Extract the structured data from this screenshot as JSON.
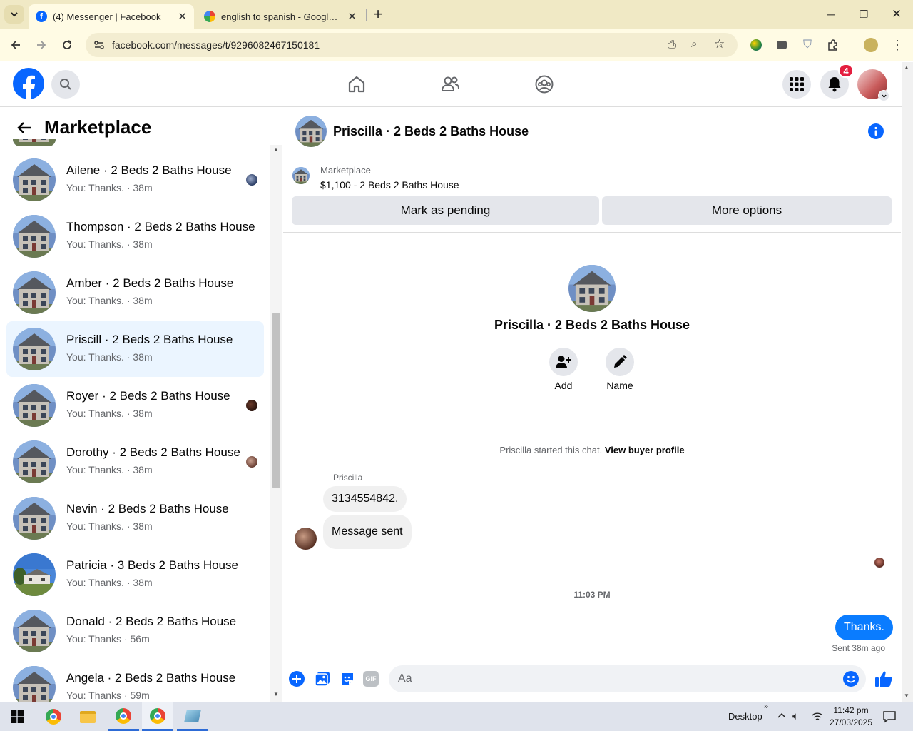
{
  "browser": {
    "tabs": [
      {
        "title": "(4) Messenger | Facebook",
        "active": true
      },
      {
        "title": "english to spanish - Google Sea",
        "active": false
      }
    ],
    "new_tab_label": "+",
    "url": "facebook.com/messages/t/9296082467150181"
  },
  "header": {
    "notification_count": "4"
  },
  "sidebar": {
    "title": "Marketplace",
    "conversations": [
      {
        "name": "Ailene · 2 Beds 2 Baths House",
        "preview": "You: Thanks. · 38m",
        "photo": "house"
      },
      {
        "name": "Thompson · 2 Beds 2 Baths House",
        "preview": "You: Thanks. · 38m",
        "photo": "house"
      },
      {
        "name": "Amber · 2 Beds 2 Baths House",
        "preview": "You: Thanks. · 38m",
        "photo": "house"
      },
      {
        "name": "Priscill · 2 Beds 2 Baths House",
        "preview": "You: Thanks. · 38m",
        "photo": "house",
        "active": true
      },
      {
        "name": "Royer · 2 Beds 2 Baths House",
        "preview": "You: Thanks. · 38m",
        "photo": "house"
      },
      {
        "name": "Dorothy · 2 Beds 2 Baths House",
        "preview": "You: Thanks. · 38m",
        "photo": "house"
      },
      {
        "name": "Nevin · 2 Beds 2 Baths House",
        "preview": "You: Thanks. · 38m",
        "photo": "house"
      },
      {
        "name": "Patricia · 3 Beds 2 Baths House",
        "preview": "You: Thanks. · 38m",
        "photo": "ranch"
      },
      {
        "name": "Donald · 2 Beds 2 Baths House",
        "preview": "You: Thanks · 56m",
        "photo": "house"
      },
      {
        "name": "Angela · 2 Beds 2 Baths House",
        "preview": "You: Thanks · 59m",
        "photo": "house"
      }
    ]
  },
  "chat": {
    "title": "Priscilla · 2 Beds 2 Baths House",
    "listing": {
      "label": "Marketplace",
      "price_title": "$1,100 - 2 Beds 2 Baths House",
      "mark_pending": "Mark as pending",
      "more_options": "More options"
    },
    "profile": {
      "title": "Priscilla · 2 Beds 2 Baths House",
      "add_label": "Add",
      "name_label": "Name"
    },
    "started_text": "Priscilla started this chat.",
    "view_buyer_profile": "View buyer profile",
    "sender_name": "Priscilla",
    "messages_in": [
      "3134554842.",
      "Message sent"
    ],
    "timestamp": "11:03 PM",
    "message_out": "Thanks.",
    "sent_status": "Sent 38m ago",
    "composer_placeholder": "Aa"
  },
  "taskbar": {
    "desktop_label": "Desktop",
    "time": "11:42 pm",
    "date": "27/03/2025"
  },
  "colors": {
    "facebook_blue": "#0866ff",
    "notification_red": "#e41e3f"
  }
}
